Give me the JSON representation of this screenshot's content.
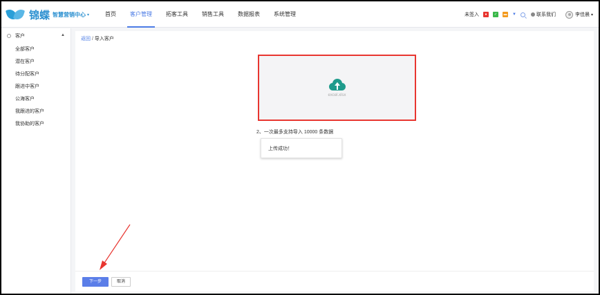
{
  "header": {
    "brand": "锦蝶",
    "brand_sub": "智慧营销中心",
    "brand_caret": "▾",
    "nav": [
      {
        "label": "首页",
        "active": false
      },
      {
        "label": "客户管理",
        "active": true
      },
      {
        "label": "拓客工具",
        "active": false
      },
      {
        "label": "销售工具",
        "active": false
      },
      {
        "label": "数据报表",
        "active": false
      },
      {
        "label": "系统管理",
        "active": false
      }
    ],
    "checkin": "未签入",
    "contact": "联系我们",
    "username": "李佳晨",
    "user_caret": "▾",
    "icons": [
      {
        "name": "red-square-icon",
        "color": "#e8352f"
      },
      {
        "name": "green-square-icon",
        "color": "#3bb84a"
      },
      {
        "name": "orange-square-icon",
        "color": "#f39a1e"
      }
    ]
  },
  "sidebar": {
    "title": "客户",
    "items": [
      "全部客户",
      "潜在客户",
      "待分配客户",
      "跟进中客户",
      "公海客户",
      "我跟进的客户",
      "我协助的客户"
    ]
  },
  "main": {
    "breadcrumb": {
      "link": "返回",
      "sep": " / ",
      "current": "导入客户"
    },
    "upload": {
      "file": "excel.xlsx"
    },
    "hint": "2、一次最多支持导入 10000 条数据",
    "toast": "上传成功！",
    "next_button": "下一步",
    "cancel_button": "取消"
  },
  "colors": {
    "accent": "#4b7be5",
    "highlight": "#e8352f",
    "cloud": "#1f9b8c"
  }
}
